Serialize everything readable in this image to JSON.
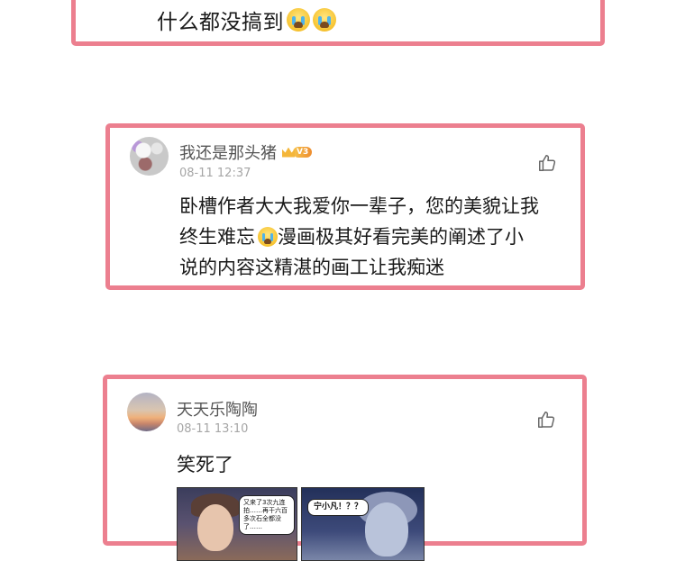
{
  "comments": [
    {
      "text_parts": [
        "什么都没搞到",
        "crying-emoji",
        "crying-emoji"
      ]
    },
    {
      "username": "我还是那头猪",
      "level_badge": "V3",
      "timestamp": "08-11 12:37",
      "lines": [
        [
          "卧槽作者大大我爱你一辈子，您的美貌让我"
        ],
        [
          "终生难忘",
          "crying-emoji",
          "漫画极其好看完美的阐述了小"
        ],
        [
          "说的内容这精湛的画工让我痴迷"
        ]
      ]
    },
    {
      "username": "天天乐陶陶",
      "timestamp": "08-11 13:10",
      "text": "笑死了",
      "comic": {
        "panel1_bubble": "又来了3次九连拍……再干六百多次石全都没了……",
        "panel2_bubble": "宁小凡！？？"
      }
    }
  ],
  "icons": {
    "like": "thumbs-up-icon",
    "emoji": "loudly-crying-face"
  },
  "colors": {
    "card_border": "#ec7f8f",
    "username": "#555555",
    "timestamp": "#a6a6a6",
    "level_badge": "#f6c34a"
  }
}
